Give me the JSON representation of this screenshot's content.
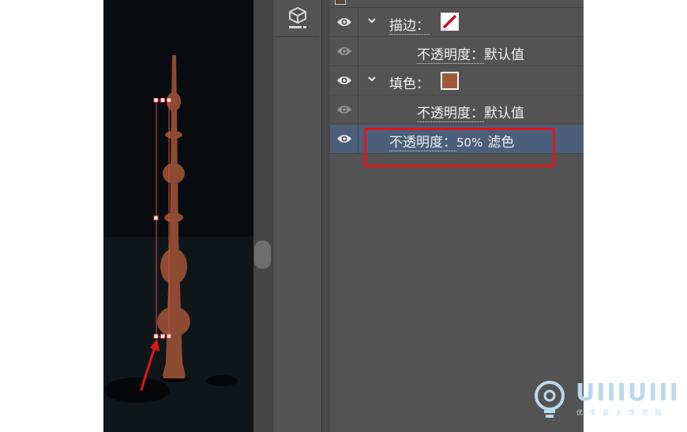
{
  "appearance_panel": {
    "rows": [
      {
        "label": "描边：",
        "type": "stroke"
      },
      {
        "label": "不透明度：",
        "value": "默认值"
      },
      {
        "label": "填色：",
        "type": "fill"
      },
      {
        "label": "不透明度：",
        "value": "默认值"
      },
      {
        "label": "不透明度：",
        "value": "50%",
        "mode": "滤色",
        "selected": true
      }
    ]
  },
  "colors": {
    "fill": "#a0583a",
    "stroke_slash": "#c4122a",
    "highlight": "#e0141c",
    "wand": "#8c4b32"
  },
  "icons": {
    "visibility": "eye-icon",
    "expand": "chevron-down-icon",
    "tool": "3d-cube-icon"
  },
  "watermark": {
    "logo": "UIIIUIII",
    "tagline": "优 学 就 上 优 优 网"
  }
}
